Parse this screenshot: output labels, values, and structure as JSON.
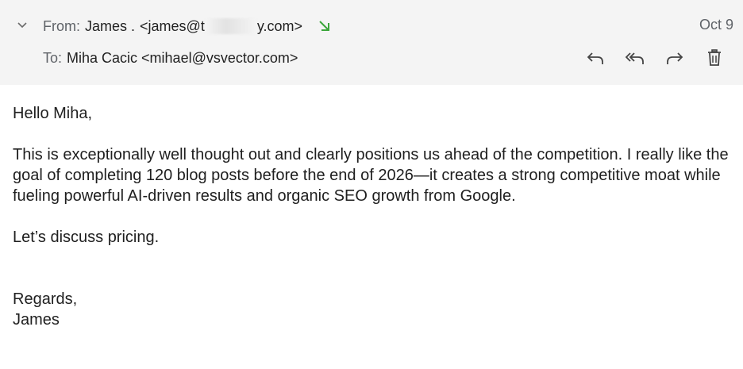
{
  "header": {
    "from_label": "From:",
    "from_name": "James .",
    "from_email_prefix": "<james@t",
    "from_email_suffix": "y.com>",
    "to_label": "To:",
    "to_value": "Miha Cacic <mihael@vsvector.com>",
    "date": "Oct 9",
    "icons": [
      "chevron-down-icon",
      "incoming-arrow-icon",
      "reply-icon",
      "reply-all-icon",
      "forward-icon",
      "trash-icon"
    ],
    "accent_color": "#3ca63c"
  },
  "body": {
    "greeting": "Hello Miha,",
    "paragraph": "This is exceptionally well thought out and clearly positions us ahead of the competition. I really like the goal of completing 120 blog posts before the end of 2026—it creates a strong competitive moat while fueling powerful AI-driven results and organic SEO growth from Google.",
    "discussion": "Let’s discuss pricing.",
    "closing": "Regards,",
    "signature": "James"
  }
}
